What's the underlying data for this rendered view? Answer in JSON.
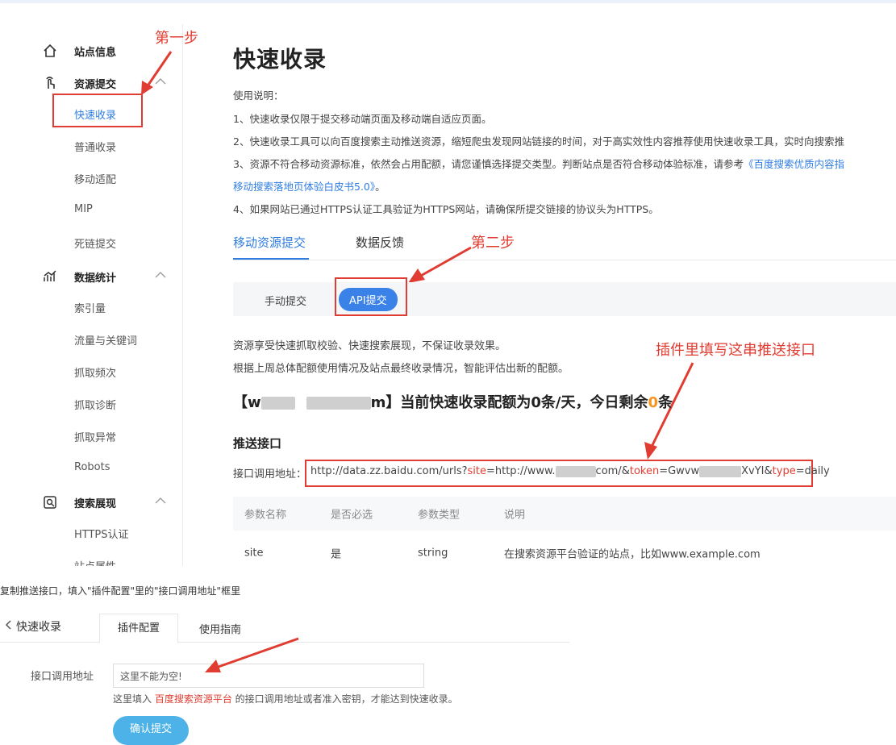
{
  "sidebar": {
    "sections": [
      {
        "label": "站点信息",
        "icon": "home-icon"
      },
      {
        "label": "资源提交",
        "icon": "hand-tap-icon"
      },
      {
        "label": "数据统计",
        "icon": "chart-line-icon"
      },
      {
        "label": "搜索展现",
        "icon": "search-box-icon"
      }
    ],
    "submit_items": [
      "快速收录",
      "普通收录",
      "移动适配",
      "MIP",
      "死链提交"
    ],
    "stats_items": [
      "索引量",
      "流量与关键词",
      "抓取频次",
      "抓取诊断",
      "抓取异常",
      "Robots"
    ],
    "search_items": [
      "HTTPS认证",
      "站点属性"
    ]
  },
  "annotations": {
    "step1": "第一步",
    "step2": "第二步",
    "fill_hint": "插件里填写这串推送接口"
  },
  "main": {
    "title": "快速收录",
    "usage_title": "使用说明：",
    "usage_lines": [
      "1、快速收录仅限于提交移动端页面及移动端自适应页面。",
      "2、快速收录工具可以向百度搜索主动推送资源，缩短爬虫发现网站链接的时间，对于高实效性内容推荐使用快速收录工具，实时向搜索推",
      "3、资源不符合移动资源标准，依然会占用配额，请您谨慎选择提交类型。判断站点是否符合移动体验标准，请参考",
      "4、如果网站已通过HTTPS认证工具验证为HTTPS网站，请确保所提交链接的协议头为HTTPS。"
    ],
    "usage_link1": "《百度搜索优质内容指",
    "usage_link2": "移动搜索落地页体验白皮书5.0》",
    "usage_link2_suffix": "。",
    "tabs": [
      "移动资源提交",
      "数据反馈"
    ],
    "subtabs": [
      "手动提交",
      "API提交"
    ],
    "notes": [
      "资源享受快速抓取校验、快速搜索展现，不保证收录效果。",
      "根据上周总体配额使用情况及站点最终收录情况，智能评估出新的配额。"
    ],
    "quota_prefix": "【w",
    "quota_mid": "m】当前快速收录配额为0条/天，今日剩余",
    "quota_remaining": "0",
    "quota_suffix": "条",
    "push_title": "推送接口",
    "endpoint_label": "接口调用地址：",
    "endpoint_parts": {
      "p1": "http://data.zz.baidu.com/urls?",
      "site_key": "site",
      "p2": "=http://www.",
      "p3": "com/&",
      "token_key": "token",
      "p4": "=Gwvw",
      "p5": "XvYI&",
      "type_key": "type",
      "p6": "=daily"
    },
    "table": {
      "headers": [
        "参数名称",
        "是否必选",
        "参数类型",
        "说明"
      ],
      "rows": [
        [
          "site",
          "是",
          "string",
          "在搜索资源平台验证的站点，比如www.example.com"
        ]
      ]
    }
  },
  "bottom": {
    "caption": "复制推送接口，填入\"插件配置\"里的\"接口调用地址\"框里",
    "back_label": "快速收录",
    "tabs": [
      "插件配置",
      "使用指南"
    ],
    "field_label": "接口调用地址",
    "field_placeholder": "这里不能为空!",
    "help_prefix": "这里填入 ",
    "help_link": "百度搜索资源平台",
    "help_suffix": " 的接口调用地址或者准入密钥，才能达到快速收录。",
    "confirm_button": "确认提交"
  },
  "colors": {
    "accent": "#2f7de1",
    "annotation_red": "#e03c31",
    "quota_orange": "#f7941d"
  }
}
